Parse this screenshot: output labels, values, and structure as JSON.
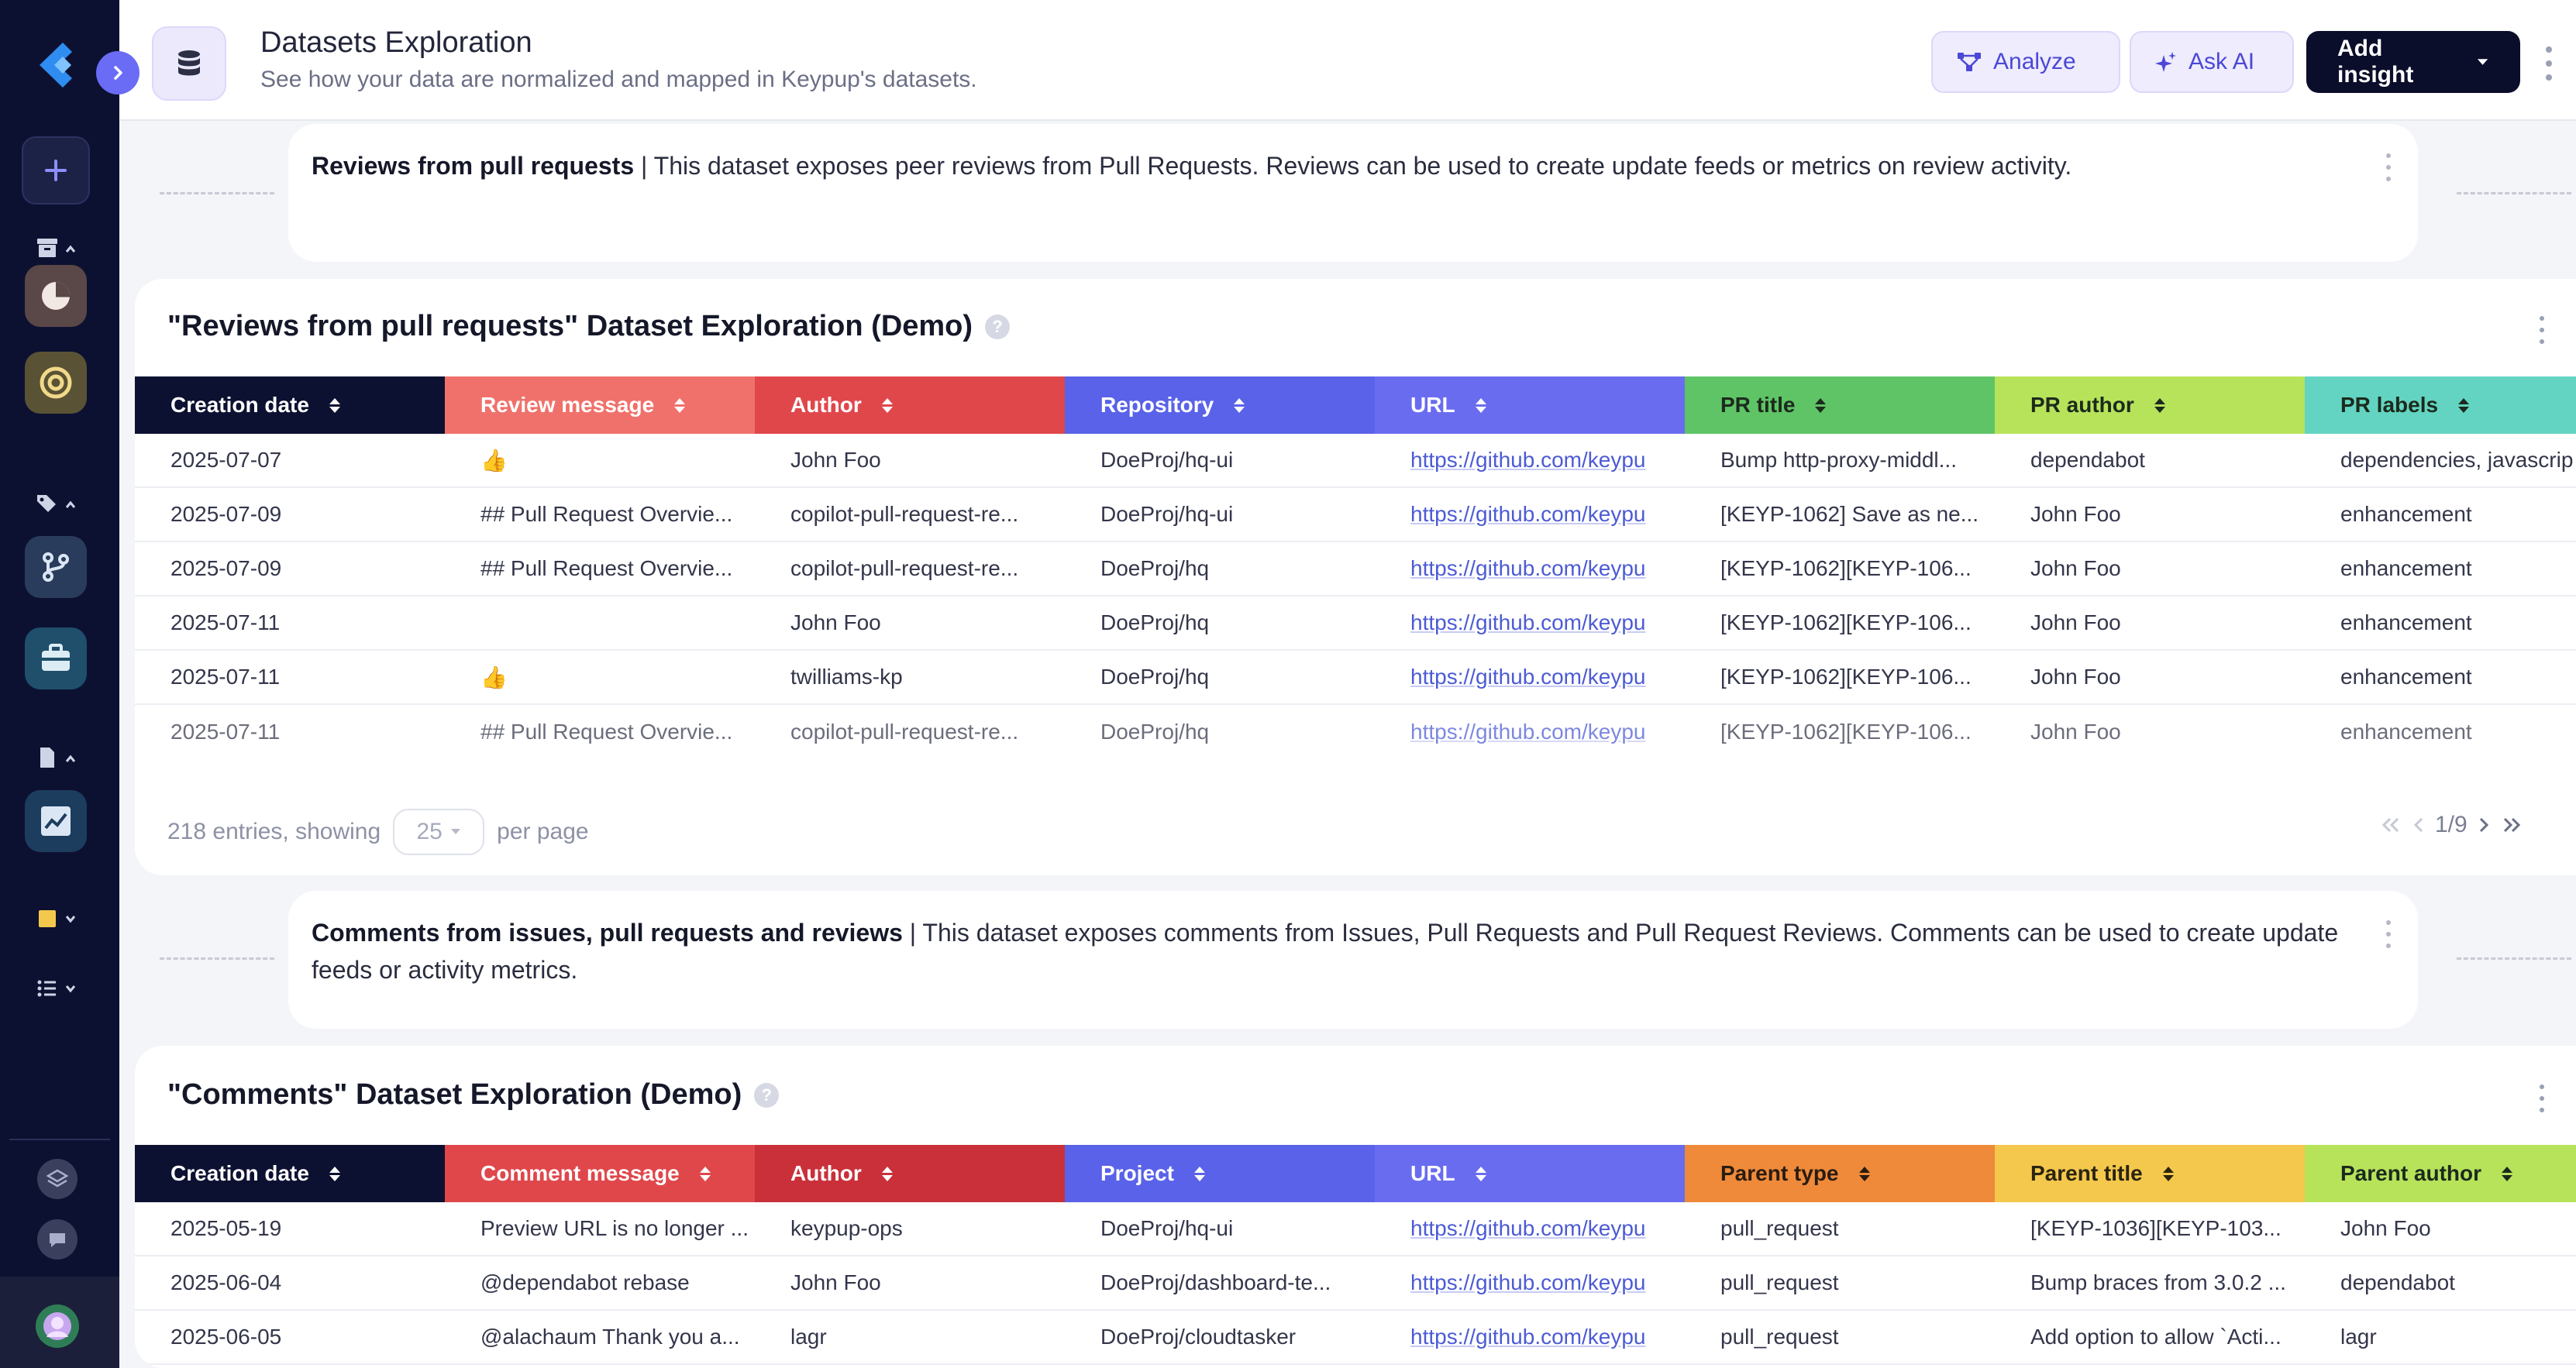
{
  "header": {
    "title": "Datasets Exploration",
    "subtitle": "See how your data are normalized and mapped in Keypup's datasets.",
    "analyze_label": "Analyze",
    "ask_ai_label": "Ask AI",
    "add_insight_label": "Add insight"
  },
  "colors": {
    "sidebar_bg": "#0d1131",
    "accent": "#6a6cf6",
    "primary_button": "#0b0e2a",
    "link": "#4c5bd4"
  },
  "reviews_note": {
    "title": "Reviews from pull requests",
    "body": " | This dataset exposes peer reviews from Pull Requests. Reviews can be used to create update feeds or metrics on review activity."
  },
  "reviews_table": {
    "title": "\"Reviews from pull requests\" Dataset Exploration (Demo)",
    "help": "?",
    "columns": [
      "Creation date",
      "Review message",
      "Author",
      "Repository",
      "URL",
      "PR title",
      "PR author",
      "PR labels"
    ],
    "rows": [
      [
        "2025-07-07",
        "👍",
        "John Foo",
        "DoeProj/hq-ui",
        "https://github.com/keypu",
        "Bump http-proxy-middl...",
        "dependabot",
        "dependencies, javascrip"
      ],
      [
        "2025-07-09",
        "## Pull Request Overvie...",
        "copilot-pull-request-re...",
        "DoeProj/hq-ui",
        "https://github.com/keypu",
        "[KEYP-1062] Save as ne...",
        "John Foo",
        "enhancement"
      ],
      [
        "2025-07-09",
        "## Pull Request Overvie...",
        "copilot-pull-request-re...",
        "DoeProj/hq",
        "https://github.com/keypu",
        "[KEYP-1062][KEYP-106...",
        "John Foo",
        "enhancement"
      ],
      [
        "2025-07-11",
        "",
        "John Foo",
        "DoeProj/hq",
        "https://github.com/keypu",
        "[KEYP-1062][KEYP-106...",
        "John Foo",
        "enhancement"
      ],
      [
        "2025-07-11",
        "👍",
        "twilliams-kp",
        "DoeProj/hq",
        "https://github.com/keypu",
        "[KEYP-1062][KEYP-106...",
        "John Foo",
        "enhancement"
      ],
      [
        "2025-07-11",
        "## Pull Request Overvie...",
        "copilot-pull-request-re...",
        "DoeProj/hq",
        "https://github.com/keypu",
        "[KEYP-1062][KEYP-106...",
        "John Foo",
        "enhancement"
      ]
    ],
    "entries_text": "218 entries, showing",
    "per_page_value": "25",
    "per_page_text": "per page",
    "page_indicator": "1/9"
  },
  "comments_note": {
    "title": "Comments from issues, pull requests and reviews",
    "body": " | This dataset exposes comments from Issues, Pull Requests and Pull Request Reviews. Comments can be used to create update feeds or activity metrics."
  },
  "comments_table": {
    "title": "\"Comments\" Dataset Exploration (Demo)",
    "help": "?",
    "columns": [
      "Creation date",
      "Comment message",
      "Author",
      "Project",
      "URL",
      "Parent type",
      "Parent title",
      "Parent author"
    ],
    "rows": [
      [
        "2025-05-19",
        "Preview URL is no longer ...",
        "keypup-ops",
        "DoeProj/hq-ui",
        "https://github.com/keypu",
        "pull_request",
        "[KEYP-1036][KEYP-103...",
        "John Foo"
      ],
      [
        "2025-06-04",
        "@dependabot rebase",
        "John Foo",
        "DoeProj/dashboard-te...",
        "https://github.com/keypu",
        "pull_request",
        "Bump braces from 3.0.2 ...",
        "dependabot"
      ],
      [
        "2025-06-05",
        "@alachaum Thank you a...",
        "lagr",
        "DoeProj/cloudtasker",
        "https://github.com/keypu",
        "pull_request",
        "Add option to allow `Acti...",
        "lagr"
      ]
    ]
  }
}
